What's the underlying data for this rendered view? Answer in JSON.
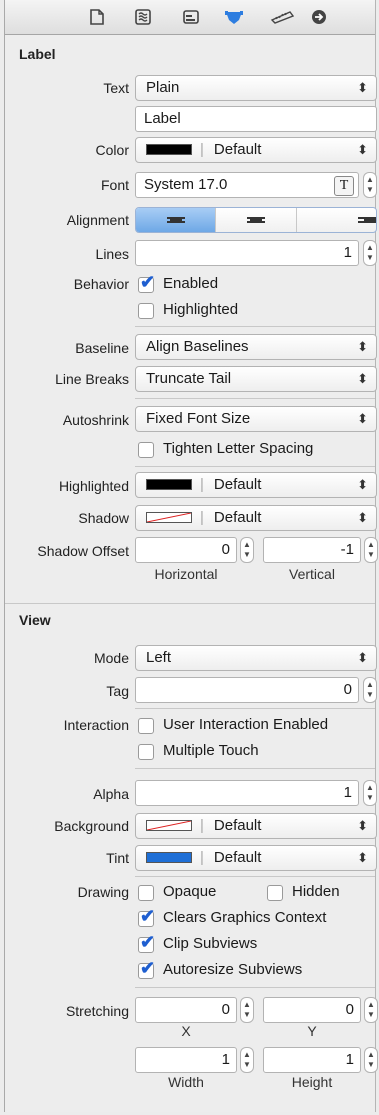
{
  "toolbar": {
    "icons": [
      "file-inspector-icon",
      "quick-help-icon",
      "identity-inspector-icon",
      "attributes-inspector-icon",
      "size-inspector-icon",
      "connections-inspector-icon"
    ]
  },
  "label_section": {
    "title": "Label",
    "text_label": "Text",
    "text_value": "Plain",
    "text_content": "Label",
    "color_label": "Color",
    "color_value": "Default",
    "font_label": "Font",
    "font_value": "System 17.0",
    "font_button": "T",
    "alignment_label": "Alignment",
    "lines_label": "Lines",
    "lines_value": "1",
    "behavior_label": "Behavior",
    "enabled_label": "Enabled",
    "highlighted_label": "Highlighted",
    "baseline_label": "Baseline",
    "baseline_value": "Align Baselines",
    "linebreaks_label": "Line Breaks",
    "linebreaks_value": "Truncate Tail",
    "autoshrink_label": "Autoshrink",
    "autoshrink_value": "Fixed Font Size",
    "tighten_label": "Tighten Letter Spacing",
    "highlighted_color_label": "Highlighted",
    "highlighted_color_value": "Default",
    "shadow_label": "Shadow",
    "shadow_value": "Default",
    "shadow_offset_label": "Shadow Offset",
    "shadow_h": "0",
    "shadow_v": "-1",
    "horizontal_label": "Horizontal",
    "vertical_label": "Vertical"
  },
  "view_section": {
    "title": "View",
    "mode_label": "Mode",
    "mode_value": "Left",
    "tag_label": "Tag",
    "tag_value": "0",
    "interaction_label": "Interaction",
    "user_interaction_label": "User Interaction Enabled",
    "multiple_touch_label": "Multiple Touch",
    "alpha_label": "Alpha",
    "alpha_value": "1",
    "background_label": "Background",
    "background_value": "Default",
    "tint_label": "Tint",
    "tint_value": "Default",
    "drawing_label": "Drawing",
    "opaque_label": "Opaque",
    "hidden_label": "Hidden",
    "clears_label": "Clears Graphics Context",
    "clip_label": "Clip Subviews",
    "autoresize_label": "Autoresize Subviews",
    "stretching_label": "Stretching",
    "x_value": "0",
    "y_value": "0",
    "width_value": "1",
    "height_value": "1",
    "x_label": "X",
    "y_label": "Y",
    "width_label": "Width",
    "height_label": "Height"
  },
  "colors": {
    "tint_swatch": "#1f6fd6",
    "accent": "#1f5fd0"
  }
}
